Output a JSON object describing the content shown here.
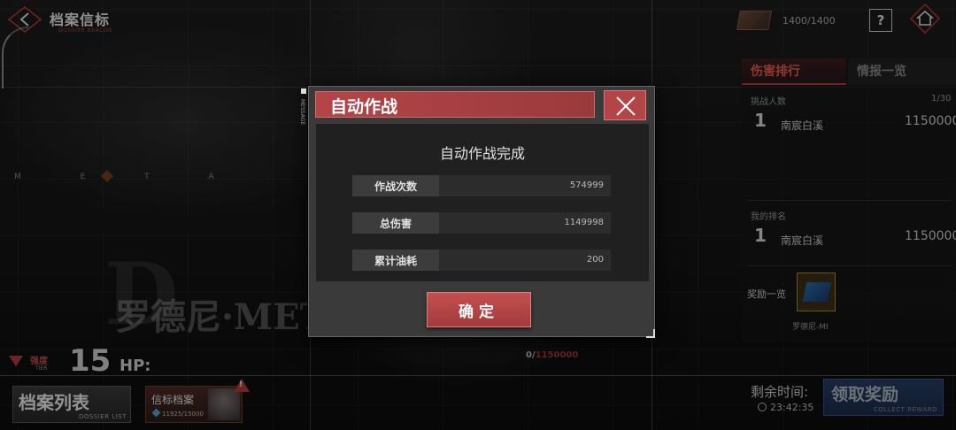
{
  "header": {
    "title": "档案信标",
    "subtitle": "DOSSIER BEACON",
    "back_icon": "back-arrow-icon"
  },
  "top_right": {
    "resource_count": "1400/1400",
    "help_label": "?",
    "home_icon": "home-icon"
  },
  "hero": {
    "meta_letters": "M E T A",
    "big_letter": "D",
    "name": "罗德尼·META",
    "tier_label": "强度",
    "tier_sub": "TIER",
    "tier_value": "15",
    "hp_label": "HP:",
    "hp_current": "0/",
    "hp_max": "1150000"
  },
  "bottom_left": {
    "dossier_title": "档案列表",
    "dossier_sub": "DOSSIER LIST",
    "beacon_title": "信标档案",
    "beacon_count": "11925/15000",
    "alert": "!"
  },
  "right_panel": {
    "tabs": [
      {
        "label": "伤害排行",
        "active": true
      },
      {
        "label": "情报一览",
        "active": false
      }
    ],
    "challengers_label": "挑战人数",
    "challengers_count": "1/30",
    "top_entry": {
      "rank": "1",
      "name": "南宸白溪",
      "damage": "1150000"
    },
    "my_rank_label": "我的排名",
    "my_entry": {
      "rank": "1",
      "name": "南宸白溪",
      "damage": "1150000"
    },
    "reward_label": "奖励一览",
    "reward_name": "罗德尼-MI"
  },
  "bottom_right": {
    "timer_label": "剩余时间:",
    "timer_value": "23:42:35",
    "claim_title": "领取奖励",
    "claim_sub": "COLLECT REWARD"
  },
  "modal": {
    "side_tag": "MESSAGE",
    "title": "自动作战",
    "message": "自动作战完成",
    "stats": [
      {
        "label": "作战次数",
        "value": "574999"
      },
      {
        "label": "总伤害",
        "value": "1149998"
      },
      {
        "label": "累计油耗",
        "value": "200"
      }
    ],
    "confirm_label": "确定"
  },
  "colors": {
    "accent_red": "#b34548",
    "claim_blue": "#2c4a7a"
  }
}
